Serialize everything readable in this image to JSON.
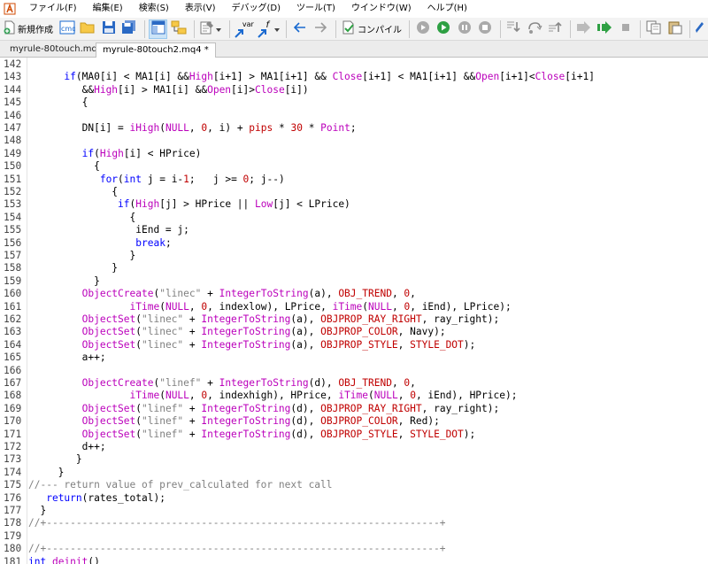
{
  "menu": [
    "ファイル(F)",
    "編集(E)",
    "検索(S)",
    "表示(V)",
    "デバッグ(D)",
    "ツール(T)",
    "ウインドウ(W)",
    "ヘルプ(H)"
  ],
  "toolbar": {
    "new_label": "新規作成",
    "compile_label": "コンパイル",
    "var_label": "var",
    "f_label": "f"
  },
  "tabs": [
    "myrule-80touch.mq4",
    "myrule-80touch2.mq4 *"
  ],
  "editor": {
    "lines": [
      {
        "n": "142",
        "t": [
          [
            "",
            ""
          ]
        ]
      },
      {
        "n": "143",
        "t": [
          [
            "      ",
            ""
          ],
          [
            "if",
            "k"
          ],
          [
            "(MA0[i] < MA1[i] &&",
            ""
          ],
          [
            "High",
            "f"
          ],
          [
            "[i+1] > MA1[i+1] && ",
            ""
          ],
          [
            "Close",
            "f"
          ],
          [
            "[i+1] < MA1[i+1] &&",
            ""
          ],
          [
            "Open",
            "f"
          ],
          [
            "[i+1]<",
            ""
          ],
          [
            "Close",
            "f"
          ],
          [
            "[i+1]",
            ""
          ]
        ]
      },
      {
        "n": "144",
        "t": [
          [
            "         &&",
            ""
          ],
          [
            "High",
            "f"
          ],
          [
            "[i] > MA1[i] &&",
            ""
          ],
          [
            "Open",
            "f"
          ],
          [
            "[i]>",
            ""
          ],
          [
            "Close",
            "f"
          ],
          [
            "[i])",
            ""
          ]
        ]
      },
      {
        "n": "145",
        "t": [
          [
            "         {",
            ""
          ]
        ]
      },
      {
        "n": "146",
        "t": [
          [
            "",
            ""
          ]
        ]
      },
      {
        "n": "147",
        "t": [
          [
            "         DN[i] = ",
            ""
          ],
          [
            "iHigh",
            "f"
          ],
          [
            "(",
            ""
          ],
          [
            "NULL",
            "f"
          ],
          [
            ", ",
            ""
          ],
          [
            "0",
            "r"
          ],
          [
            ", i) + ",
            ""
          ],
          [
            "pips",
            "r"
          ],
          [
            " * ",
            ""
          ],
          [
            "30",
            "r"
          ],
          [
            " * ",
            ""
          ],
          [
            "Point",
            "f"
          ],
          [
            ";",
            ""
          ]
        ]
      },
      {
        "n": "148",
        "t": [
          [
            "",
            ""
          ]
        ]
      },
      {
        "n": "149",
        "t": [
          [
            "         ",
            ""
          ],
          [
            "if",
            "k"
          ],
          [
            "(",
            ""
          ],
          [
            "High",
            "f"
          ],
          [
            "[i] < HPrice)",
            ""
          ]
        ]
      },
      {
        "n": "150",
        "t": [
          [
            "           {",
            ""
          ]
        ]
      },
      {
        "n": "151",
        "t": [
          [
            "            ",
            ""
          ],
          [
            "for",
            "k"
          ],
          [
            "(",
            ""
          ],
          [
            "int",
            "k"
          ],
          [
            " j = i-",
            ""
          ],
          [
            "1",
            "r"
          ],
          [
            ";   j >= ",
            ""
          ],
          [
            "0",
            "r"
          ],
          [
            "; j--)",
            ""
          ]
        ]
      },
      {
        "n": "152",
        "t": [
          [
            "              {",
            ""
          ]
        ]
      },
      {
        "n": "153",
        "t": [
          [
            "               ",
            ""
          ],
          [
            "if",
            "k"
          ],
          [
            "(",
            ""
          ],
          [
            "High",
            "f"
          ],
          [
            "[j] > HPrice || ",
            ""
          ],
          [
            "Low",
            "f"
          ],
          [
            "[j] < LPrice)",
            ""
          ]
        ]
      },
      {
        "n": "154",
        "t": [
          [
            "                 {",
            ""
          ]
        ]
      },
      {
        "n": "155",
        "t": [
          [
            "                  iEnd = j;",
            ""
          ]
        ]
      },
      {
        "n": "156",
        "t": [
          [
            "                  ",
            ""
          ],
          [
            "break",
            "k"
          ],
          [
            ";",
            ""
          ]
        ]
      },
      {
        "n": "157",
        "t": [
          [
            "                 }",
            ""
          ]
        ]
      },
      {
        "n": "158",
        "t": [
          [
            "              }",
            ""
          ]
        ]
      },
      {
        "n": "159",
        "t": [
          [
            "           }",
            ""
          ]
        ]
      },
      {
        "n": "160",
        "t": [
          [
            "         ",
            ""
          ],
          [
            "ObjectCreate",
            "f"
          ],
          [
            "(",
            ""
          ],
          [
            "\"linec\"",
            "c"
          ],
          [
            " + ",
            ""
          ],
          [
            "IntegerToString",
            "f"
          ],
          [
            "(a), ",
            ""
          ],
          [
            "OBJ_TREND",
            "r"
          ],
          [
            ", ",
            ""
          ],
          [
            "0",
            "r"
          ],
          [
            ",",
            ""
          ]
        ]
      },
      {
        "n": "161",
        "t": [
          [
            "                 ",
            ""
          ],
          [
            "iTime",
            "f"
          ],
          [
            "(",
            ""
          ],
          [
            "NULL",
            "f"
          ],
          [
            ", ",
            ""
          ],
          [
            "0",
            "r"
          ],
          [
            ", indexlow), LPrice, ",
            ""
          ],
          [
            "iTime",
            "f"
          ],
          [
            "(",
            ""
          ],
          [
            "NULL",
            "f"
          ],
          [
            ", ",
            ""
          ],
          [
            "0",
            "r"
          ],
          [
            ", iEnd), LPrice);",
            ""
          ]
        ]
      },
      {
        "n": "162",
        "t": [
          [
            "         ",
            ""
          ],
          [
            "ObjectSet",
            "f"
          ],
          [
            "(",
            ""
          ],
          [
            "\"linec\"",
            "c"
          ],
          [
            " + ",
            ""
          ],
          [
            "IntegerToString",
            "f"
          ],
          [
            "(a), ",
            ""
          ],
          [
            "OBJPROP_RAY_RIGHT",
            "r"
          ],
          [
            ", ray_right);",
            ""
          ]
        ]
      },
      {
        "n": "163",
        "t": [
          [
            "         ",
            ""
          ],
          [
            "ObjectSet",
            "f"
          ],
          [
            "(",
            ""
          ],
          [
            "\"linec\"",
            "c"
          ],
          [
            " + ",
            ""
          ],
          [
            "IntegerToString",
            "f"
          ],
          [
            "(a), ",
            ""
          ],
          [
            "OBJPROP_COLOR",
            "r"
          ],
          [
            ", Navy);",
            ""
          ]
        ]
      },
      {
        "n": "164",
        "t": [
          [
            "         ",
            ""
          ],
          [
            "ObjectSet",
            "f"
          ],
          [
            "(",
            ""
          ],
          [
            "\"linec\"",
            "c"
          ],
          [
            " + ",
            ""
          ],
          [
            "IntegerToString",
            "f"
          ],
          [
            "(a), ",
            ""
          ],
          [
            "OBJPROP_STYLE",
            "r"
          ],
          [
            ", ",
            ""
          ],
          [
            "STYLE_DOT",
            "r"
          ],
          [
            ");",
            ""
          ]
        ]
      },
      {
        "n": "165",
        "t": [
          [
            "         a++;",
            ""
          ]
        ]
      },
      {
        "n": "166",
        "t": [
          [
            "",
            ""
          ]
        ]
      },
      {
        "n": "167",
        "t": [
          [
            "         ",
            ""
          ],
          [
            "ObjectCreate",
            "f"
          ],
          [
            "(",
            ""
          ],
          [
            "\"linef\"",
            "c"
          ],
          [
            " + ",
            ""
          ],
          [
            "IntegerToString",
            "f"
          ],
          [
            "(d), ",
            ""
          ],
          [
            "OBJ_TREND",
            "r"
          ],
          [
            ", ",
            ""
          ],
          [
            "0",
            "r"
          ],
          [
            ",",
            ""
          ]
        ]
      },
      {
        "n": "168",
        "t": [
          [
            "                 ",
            ""
          ],
          [
            "iTime",
            "f"
          ],
          [
            "(",
            ""
          ],
          [
            "NULL",
            "f"
          ],
          [
            ", ",
            ""
          ],
          [
            "0",
            "r"
          ],
          [
            ", indexhigh), HPrice, ",
            ""
          ],
          [
            "iTime",
            "f"
          ],
          [
            "(",
            ""
          ],
          [
            "NULL",
            "f"
          ],
          [
            ", ",
            ""
          ],
          [
            "0",
            "r"
          ],
          [
            ", iEnd), HPrice);",
            ""
          ]
        ]
      },
      {
        "n": "169",
        "t": [
          [
            "         ",
            ""
          ],
          [
            "ObjectSet",
            "f"
          ],
          [
            "(",
            ""
          ],
          [
            "\"linef\"",
            "c"
          ],
          [
            " + ",
            ""
          ],
          [
            "IntegerToString",
            "f"
          ],
          [
            "(d), ",
            ""
          ],
          [
            "OBJPROP_RAY_RIGHT",
            "r"
          ],
          [
            ", ray_right);",
            ""
          ]
        ]
      },
      {
        "n": "170",
        "t": [
          [
            "         ",
            ""
          ],
          [
            "ObjectSet",
            "f"
          ],
          [
            "(",
            ""
          ],
          [
            "\"linef\"",
            "c"
          ],
          [
            " + ",
            ""
          ],
          [
            "IntegerToString",
            "f"
          ],
          [
            "(d), ",
            ""
          ],
          [
            "OBJPROP_COLOR",
            "r"
          ],
          [
            ", Red);",
            ""
          ]
        ]
      },
      {
        "n": "171",
        "t": [
          [
            "         ",
            ""
          ],
          [
            "ObjectSet",
            "f"
          ],
          [
            "(",
            ""
          ],
          [
            "\"linef\"",
            "c"
          ],
          [
            " + ",
            ""
          ],
          [
            "IntegerToString",
            "f"
          ],
          [
            "(d), ",
            ""
          ],
          [
            "OBJPROP_STYLE",
            "r"
          ],
          [
            ", ",
            ""
          ],
          [
            "STYLE_DOT",
            "r"
          ],
          [
            ");",
            ""
          ]
        ]
      },
      {
        "n": "172",
        "t": [
          [
            "         d++;",
            ""
          ]
        ]
      },
      {
        "n": "173",
        "t": [
          [
            "        }",
            ""
          ]
        ]
      },
      {
        "n": "174",
        "t": [
          [
            "     }",
            ""
          ]
        ]
      },
      {
        "n": "175",
        "t": [
          [
            "//--- return value of prev_calculated for next call",
            "c"
          ]
        ]
      },
      {
        "n": "176",
        "t": [
          [
            "   ",
            ""
          ],
          [
            "return",
            "k"
          ],
          [
            "(rates_total);",
            ""
          ]
        ]
      },
      {
        "n": "177",
        "t": [
          [
            "  }",
            ""
          ]
        ]
      },
      {
        "n": "178",
        "t": [
          [
            "//+------------------------------------------------------------------+",
            "c"
          ]
        ]
      },
      {
        "n": "179",
        "t": [
          [
            "",
            ""
          ]
        ]
      },
      {
        "n": "180",
        "t": [
          [
            "//+------------------------------------------------------------------+",
            "c"
          ]
        ]
      },
      {
        "n": "181",
        "t": [
          [
            "",
            ""
          ],
          [
            "int",
            "k"
          ],
          [
            " ",
            ""
          ],
          [
            "deinit",
            "f"
          ],
          [
            "()",
            ""
          ]
        ]
      }
    ]
  }
}
